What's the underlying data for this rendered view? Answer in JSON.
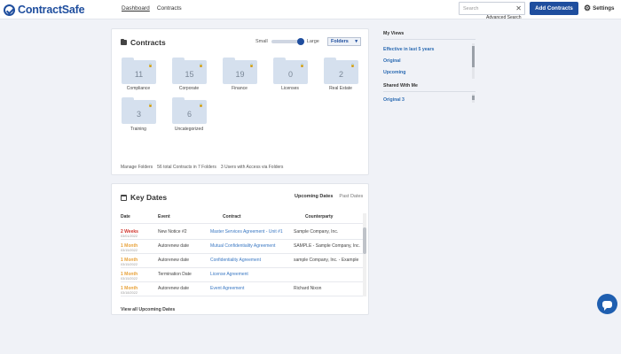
{
  "header": {
    "logo_text": "ContractSafe",
    "nav": [
      "Dashboard",
      "Contracts"
    ],
    "search_placeholder": "Search",
    "advanced_search": "Advanced Search",
    "add_button": "Add Contracts",
    "settings": "Settings"
  },
  "contracts": {
    "title": "Contracts",
    "size_small": "Small",
    "size_large": "Large",
    "view_select": "Folders",
    "folders": [
      {
        "count": "11",
        "label": "Compliance"
      },
      {
        "count": "15",
        "label": "Corporate"
      },
      {
        "count": "19",
        "label": "Finance"
      },
      {
        "count": "0",
        "label": "Licenses"
      },
      {
        "count": "2",
        "label": "Real Estate"
      },
      {
        "count": "3",
        "label": "Training"
      },
      {
        "count": "6",
        "label": "Uncategorized"
      }
    ],
    "footer": {
      "manage": "Manage Folders",
      "total": "56 total Contracts in 7 Folders",
      "users": "3 Users with Access via Folders"
    }
  },
  "key_dates": {
    "title": "Key Dates",
    "tabs": [
      "Upcoming Dates",
      "Past Dates"
    ],
    "columns": [
      "Date",
      "Event",
      "Contract",
      "Counterparty"
    ],
    "rows": [
      {
        "date": "2 Weeks",
        "sub": "03/01/2022",
        "event": "New Notice #2",
        "contract": "Master Services Agreement - Unit #1",
        "counterparty": "Sample Company, Inc."
      },
      {
        "date": "1 Month",
        "sub": "03/15/2022",
        "event": "Autorenew date",
        "contract": "Mutual Confidentiality Agreement",
        "counterparty": "SAMPLE - Sample Company, Inc."
      },
      {
        "date": "1 Month",
        "sub": "03/15/2022",
        "event": "Autorenew date",
        "contract": "Confidentiality Agreement",
        "counterparty": "sample Company, Inc. - Example"
      },
      {
        "date": "1 Month",
        "sub": "03/15/2022",
        "event": "Termination Date",
        "contract": "License Agreement",
        "counterparty": ""
      },
      {
        "date": "1 Month",
        "sub": "03/18/2022",
        "event": "Autorenew date",
        "contract": "Event Agreement",
        "counterparty": "Richard Nixon"
      }
    ],
    "footer": "View all Upcoming Dates"
  },
  "right_panel": {
    "my_views_title": "My Views",
    "my_views": [
      "Effective in last 5 years",
      "Original",
      "Upcoming"
    ],
    "shared_title": "Shared With Me",
    "shared": [
      "Original 3"
    ]
  }
}
